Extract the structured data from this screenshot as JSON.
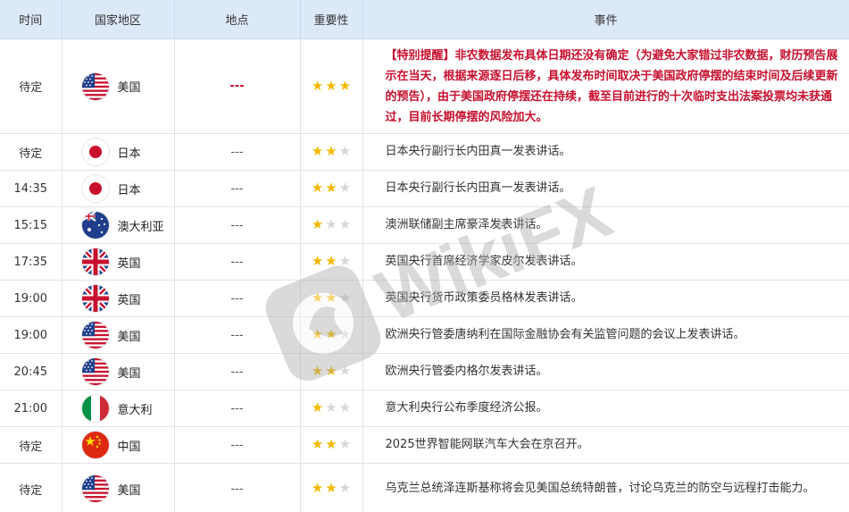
{
  "headers": {
    "time": "时间",
    "country": "国家地区",
    "place": "地点",
    "importance": "重要性",
    "event": "事件"
  },
  "rows": [
    {
      "time": "待定",
      "flag": "us",
      "country": "美国",
      "place": "---",
      "stars": 3,
      "event": "【特别提醒】非农数据发布具体日期还没有确定（为避免大家错过非农数据，财历预告展示在当天，根据来源逐日后移，具体发布时间取决于美国政府停摆的结束时间及后续更新的预告），由于美国政府停摆还在持续，截至目前进行的十次临时支出法案投票均未获通过，目前长期停摆的风险加大。",
      "highlight": true
    },
    {
      "time": "待定",
      "flag": "jp",
      "country": "日本",
      "place": "---",
      "stars": 2,
      "event": "日本央行副行长内田真一发表讲话。"
    },
    {
      "time": "14:35",
      "flag": "jp",
      "country": "日本",
      "place": "---",
      "stars": 2,
      "event": "日本央行副行长内田真一发表讲话。"
    },
    {
      "time": "15:15",
      "flag": "au",
      "country": "澳大利亚",
      "place": "---",
      "stars": 1,
      "event": "澳洲联储副主席豪泽发表讲话。"
    },
    {
      "time": "17:35",
      "flag": "gb",
      "country": "英国",
      "place": "---",
      "stars": 2,
      "event": "英国央行首席经济学家皮尔发表讲话。"
    },
    {
      "time": "19:00",
      "flag": "gb",
      "country": "英国",
      "place": "---",
      "stars": 2,
      "event": "英国央行货币政策委员格林发表讲话。"
    },
    {
      "time": "19:00",
      "flag": "us",
      "country": "美国",
      "place": "---",
      "stars": 2,
      "event": "欧洲央行管委唐纳利在国际金融协会有关监管问题的会议上发表讲话。"
    },
    {
      "time": "20:45",
      "flag": "us",
      "country": "美国",
      "place": "---",
      "stars": 2,
      "event": "欧洲央行管委内格尔发表讲话。"
    },
    {
      "time": "21:00",
      "flag": "it",
      "country": "意大利",
      "place": "---",
      "stars": 1,
      "event": "意大利央行公布季度经济公报。"
    },
    {
      "time": "待定",
      "flag": "cn",
      "country": "中国",
      "place": "---",
      "stars": 2,
      "event": "2025世界智能网联汽车大会在京召开。"
    },
    {
      "time": "待定",
      "flag": "us",
      "country": "美国",
      "place": "---",
      "stars": 2,
      "event": "乌克兰总统泽连斯基称将会见美国总统特朗普，讨论乌克兰的防空与远程打击能力。"
    }
  ],
  "watermark": {
    "text": "WikiFX"
  },
  "colors": {
    "header_bg": "#dce9f8",
    "highlight": "#c8102e",
    "star_on": "#f5b800",
    "star_off": "#d7d7d7"
  }
}
